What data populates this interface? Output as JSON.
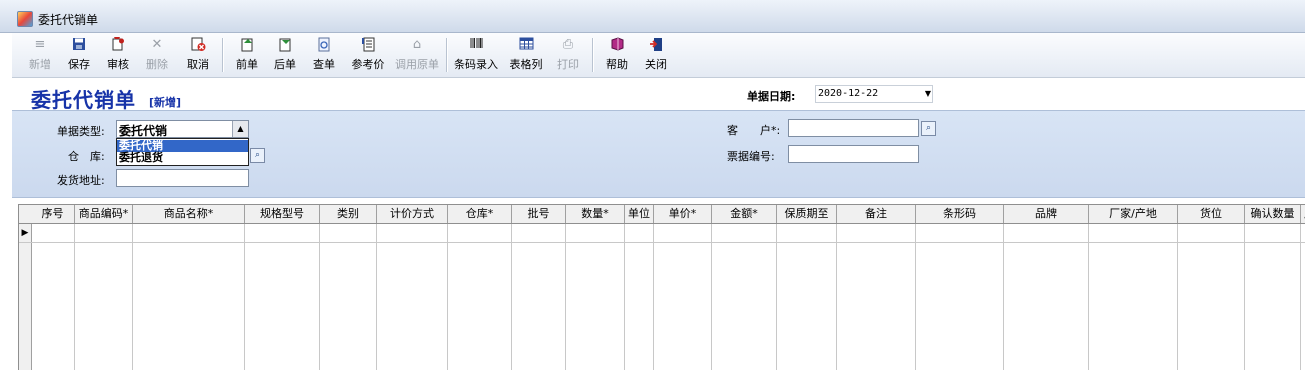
{
  "window": {
    "title": "委托代销单"
  },
  "toolbar": {
    "buttons": [
      {
        "label": "新增",
        "icon": "new-icon",
        "enabled": false
      },
      {
        "label": "保存",
        "icon": "save-icon",
        "enabled": true
      },
      {
        "label": "审核",
        "icon": "audit-icon",
        "enabled": true
      },
      {
        "label": "删除",
        "icon": "delete-icon",
        "enabled": false
      },
      {
        "label": "取消",
        "icon": "cancel-icon",
        "enabled": true
      },
      {
        "label": "前单",
        "icon": "previous-record-icon",
        "enabled": true
      },
      {
        "label": "后单",
        "icon": "next-record-icon",
        "enabled": true
      },
      {
        "label": "查单",
        "icon": "search-record-icon",
        "enabled": true
      },
      {
        "label": "参考价",
        "icon": "reference-price-icon",
        "enabled": true
      },
      {
        "label": "调用原单",
        "icon": "load-original-icon",
        "enabled": false
      },
      {
        "label": "条码录入",
        "icon": "barcode-icon",
        "enabled": true
      },
      {
        "label": "表格列",
        "icon": "table-columns-icon",
        "enabled": true
      },
      {
        "label": "打印",
        "icon": "print-icon",
        "enabled": false
      },
      {
        "label": "帮助",
        "icon": "help-book-icon",
        "enabled": true
      },
      {
        "label": "关闭",
        "icon": "exit-door-icon",
        "enabled": true
      }
    ]
  },
  "heading": {
    "title": "委托代销单",
    "mode": "[新增]",
    "date_label": "单据日期:",
    "date_value": "2020-12-22"
  },
  "form": {
    "doc_type_label": "单据类型:",
    "doc_type_value": "委托代销",
    "doc_type_options": [
      "委托代销",
      "委托退货"
    ],
    "warehouse_label": "仓　库:",
    "warehouse_value": "",
    "address_label": "发货地址:",
    "address_value": "",
    "customer_label": "客　　户*:",
    "customer_value": "",
    "invoice_label": "票据编号:",
    "invoice_value": ""
  },
  "grid": {
    "columns": [
      "序号",
      "商品编码*",
      "商品名称*",
      "规格型号",
      "类别",
      "计价方式",
      "仓库*",
      "批号",
      "数量*",
      "单位",
      "单价*",
      "金额*",
      "保质期至",
      "备注",
      "条形码",
      "品牌",
      "厂家/产地",
      "货位",
      "确认数量",
      "成"
    ],
    "rows": []
  },
  "colors": {
    "accent_blue": "#1733a8",
    "selection": "#3267c8",
    "panel": "#cbd9ee"
  }
}
